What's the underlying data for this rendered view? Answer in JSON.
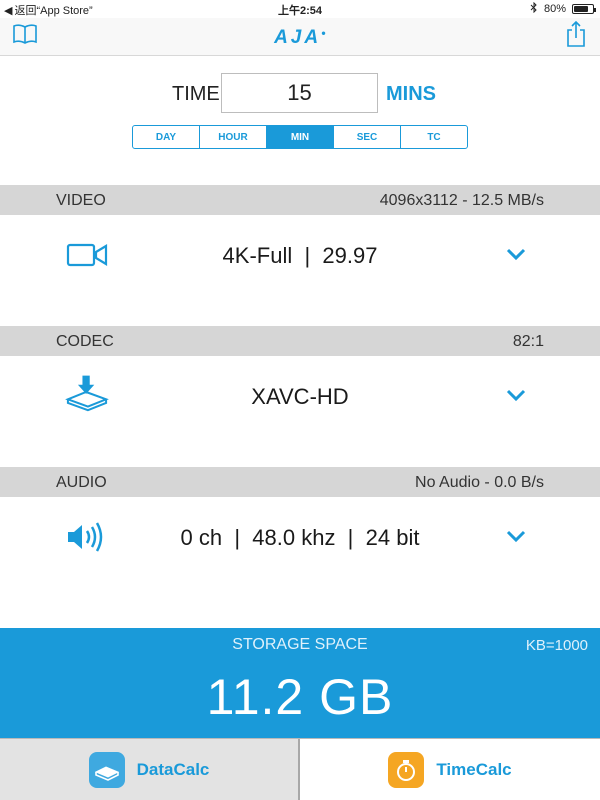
{
  "status_bar": {
    "back_label": "返回“App Store”",
    "time": "上午2:54",
    "battery_text": "80%",
    "battery_level": 0.8
  },
  "nav": {
    "logo": "AJA",
    "left_icon": "book-icon",
    "right_icon": "share-icon"
  },
  "time_entry": {
    "label": "TIME",
    "value": "15",
    "units": "MINS"
  },
  "time_modes": {
    "options": [
      "DAY",
      "HOUR",
      "MIN",
      "SEC",
      "TC"
    ],
    "selected": "MIN"
  },
  "video": {
    "title": "VIDEO",
    "info": "4096x3112 - 12.5 MB/s",
    "value": "4K-Full  |  29.97",
    "icon": "video-camera-icon"
  },
  "codec": {
    "title": "CODEC",
    "info": "82:1",
    "value": "XAVC-HD",
    "icon": "disk-drive-icon"
  },
  "audio": {
    "title": "AUDIO",
    "info": "No Audio - 0.0 B/s",
    "value": "0 ch  |  48.0 khz  |  24 bit",
    "icon": "speaker-icon"
  },
  "storage": {
    "label": "STORAGE SPACE",
    "unit_mode": "KB=1000",
    "value": "11.2 GB"
  },
  "tabs": [
    {
      "label": "DataCalc",
      "icon": "datacalc-icon",
      "active": false
    },
    {
      "label": "TimeCalc",
      "icon": "stopwatch-icon",
      "active": true
    }
  ],
  "colors": {
    "accent": "#1a9ad9",
    "header_bg": "#d6d6d6",
    "timecalc_icon": "#f5a623"
  }
}
